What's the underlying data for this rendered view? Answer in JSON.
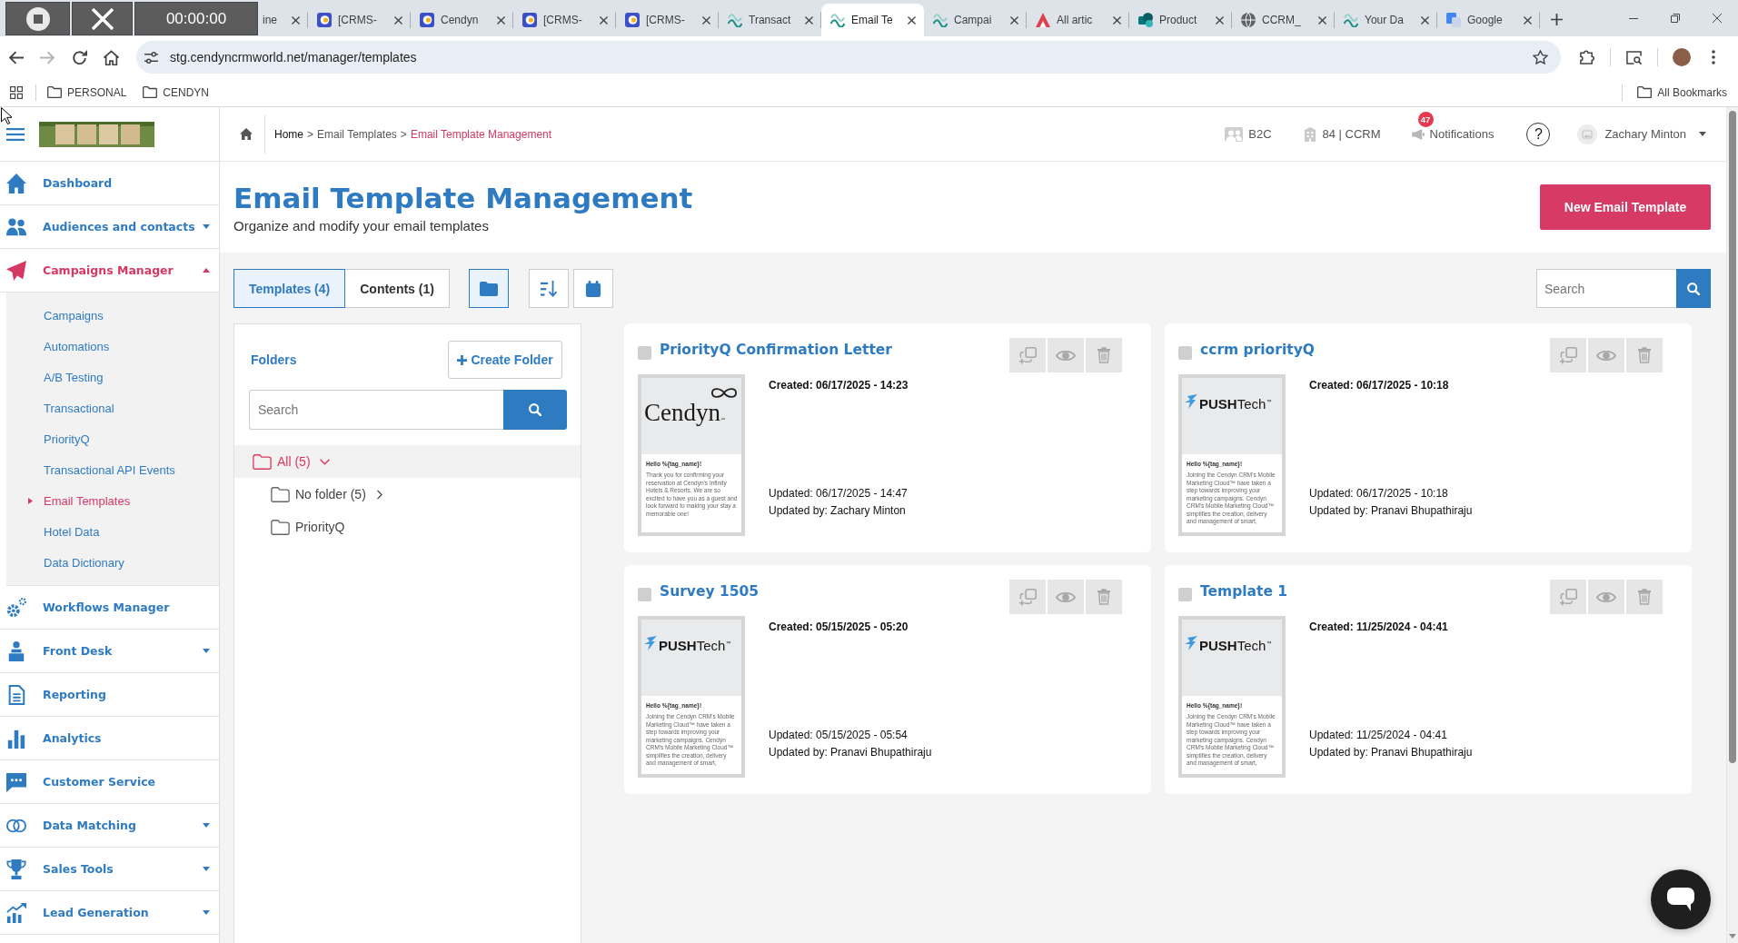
{
  "recorder": {
    "timer": "00:00:00"
  },
  "browser": {
    "tabs": [
      {
        "title": "ine",
        "selected": false
      },
      {
        "title": "[CRMS-",
        "kind": "app",
        "selected": false
      },
      {
        "title": "Cendyn",
        "kind": "app",
        "selected": false
      },
      {
        "title": "[CRMS-",
        "kind": "app",
        "selected": false
      },
      {
        "title": "[CRMS-",
        "kind": "app",
        "selected": false
      },
      {
        "title": "Transact",
        "kind": "wave",
        "selected": false
      },
      {
        "title": "Email Te",
        "kind": "wave",
        "selected": true
      },
      {
        "title": "Campai",
        "kind": "wave",
        "selected": false
      },
      {
        "title": "All artic",
        "kind": "triangle",
        "selected": false
      },
      {
        "title": "Product",
        "kind": "share",
        "selected": false
      },
      {
        "title": "CCRM_",
        "kind": "globe",
        "selected": false
      },
      {
        "title": "Your Da",
        "kind": "wave",
        "selected": false
      },
      {
        "title": "Google",
        "kind": "translate",
        "selected": false
      }
    ],
    "address_bar": {
      "url": "stg.cendyncrmworld.net/manager/templates"
    },
    "bookmarks": [
      {
        "label": "PERSONAL"
      },
      {
        "label": "CENDYN"
      }
    ],
    "all_bookmarks": {
      "label": "All Bookmarks"
    }
  },
  "sidebar": {
    "items": [
      {
        "label": "Dashboard",
        "kind": "home",
        "selected": false
      },
      {
        "label": "Audiences and contacts",
        "kind": "people",
        "selected": false,
        "expanded": false
      },
      {
        "label": "Campaigns Manager",
        "kind": "plane",
        "selected": true,
        "expanded": true,
        "children": [
          {
            "label": "Campaigns",
            "selected": false
          },
          {
            "label": "Automations",
            "selected": false
          },
          {
            "label": "A/B Testing",
            "selected": false
          },
          {
            "label": "Transactional",
            "selected": false
          },
          {
            "label": "PriorityQ",
            "selected": false
          },
          {
            "label": "Transactional API Events",
            "selected": false
          },
          {
            "label": "Email Templates",
            "selected": true
          },
          {
            "label": "Hotel Data",
            "selected": false
          },
          {
            "label": "Data Dictionary",
            "selected": false
          }
        ]
      },
      {
        "label": "Workflows Manager",
        "kind": "gears",
        "selected": false
      },
      {
        "label": "Front Desk",
        "kind": "desk",
        "selected": false,
        "expanded": false
      },
      {
        "label": "Reporting",
        "kind": "report",
        "selected": false
      },
      {
        "label": "Analytics",
        "kind": "bars",
        "selected": false
      },
      {
        "label": "Customer Service",
        "kind": "chat",
        "selected": false
      },
      {
        "label": "Data Matching",
        "kind": "rings",
        "selected": false,
        "expanded": false
      },
      {
        "label": "Sales Tools",
        "kind": "trophy",
        "selected": false,
        "expanded": false
      },
      {
        "label": "Lead Generation",
        "kind": "growth",
        "selected": false,
        "expanded": false
      }
    ]
  },
  "header": {
    "breadcrumb": [
      {
        "label": "Home",
        "kind": "root"
      },
      {
        "label": ">",
        "kind": "separator"
      },
      {
        "label": "Email Templates",
        "kind": "link"
      },
      {
        "label": ">",
        "kind": "separator"
      },
      {
        "label": "Email Template Management",
        "kind": "current"
      }
    ],
    "account": "B2C",
    "property": "84 | CCRM",
    "notifications": {
      "label": "Notifications",
      "count": "47"
    },
    "help": "?",
    "user": "Zachary Minton"
  },
  "page": {
    "title": "Email Template Management",
    "subtitle": "Organize and modify your email templates",
    "new_button": "New Email Template"
  },
  "view_tabs": [
    {
      "label": "Templates (4)",
      "selected": true
    },
    {
      "label": "Contents (1)",
      "selected": false
    }
  ],
  "tools": [
    {
      "kind": "folder",
      "selected": true
    },
    {
      "kind": "sort",
      "selected": false
    },
    {
      "kind": "calendar",
      "selected": false
    }
  ],
  "search": {
    "placeholder": "Search"
  },
  "folders": {
    "title": "Folders",
    "create_button": "Create Folder",
    "search_placeholder": "Search",
    "tree": [
      {
        "label": "All (5)",
        "selected": true,
        "expanded": true,
        "children": [
          {
            "label": "No folder (5)",
            "selected": false,
            "expanded": false
          },
          {
            "label": "PriorityQ",
            "selected": false
          }
        ]
      }
    ]
  },
  "templates": [
    {
      "title": "PriorityQ Confirmation Letter",
      "checked": false,
      "created": "Created: 06/17/2025 - 14:23",
      "updated": "Updated: 06/17/2025 - 14:47",
      "updated_by": "Updated by: Zachary Minton",
      "preview": {
        "kind": "infinity",
        "logo": "Cendyn$_{™}$",
        "greeting": "Hello %{tag_name}!",
        "body": "Thank you for confirming your reservation at Cendyn's Infinity Hotels & Resorts. We are so excited to have you as a guest and look forward to making your stay a memorable one!"
      }
    },
    {
      "title": "ccrm priorityQ",
      "checked": false,
      "created": "Created: 06/17/2025 - 10:18",
      "updated": "Updated: 06/17/2025 - 10:18",
      "updated_by": "Updated by: Pranavi Bhupathiraju",
      "preview": {
        "kind": "bolt",
        "logo": "**PUSH**Tech$^{™}$",
        "greeting": "Hello %{tag_name}!",
        "body": "Joining the Cendyn CRM's Mobile Marketing Cloud™ have taken a step towards improving your marketing campaigns. Cendyn CRM's Mobile Marketing Cloud™ simplifies the creation, delivery and management of smart,"
      }
    },
    {
      "title": "Survey 1505",
      "checked": false,
      "created": "Created: 05/15/2025 - 05:20",
      "updated": "Updated: 05/15/2025 - 05:54",
      "updated_by": "Updated by: Pranavi Bhupathiraju",
      "preview": {
        "kind": "bolt",
        "logo": "**PUSH**Tech$^{™}$",
        "greeting": "Hello %{tag_name}!",
        "body": "Joining the Cendyn CRM's Mobile Marketing Cloud™ have taken a step towards improving your marketing campaigns. Cendyn CRM's Mobile Marketing Cloud™ simplifies the creation, delivery and management of smart,"
      }
    },
    {
      "title": "Template 1",
      "checked": false,
      "created": "Created: 11/25/2024 - 04:41",
      "updated": "Updated: 11/25/2024 - 04:41",
      "updated_by": "Updated by: Pranavi Bhupathiraju",
      "preview": {
        "kind": "bolt",
        "logo": "**PUSH**Tech$^{™}$",
        "greeting": "Hello %{tag_name}!",
        "body": "Joining the Cendyn CRM's Mobile Marketing Cloud™ have taken a step towards improving your marketing campaigns. Cendyn CRM's Mobile Marketing Cloud™ simplifies the creation, delivery and management of smart,"
      }
    }
  ]
}
